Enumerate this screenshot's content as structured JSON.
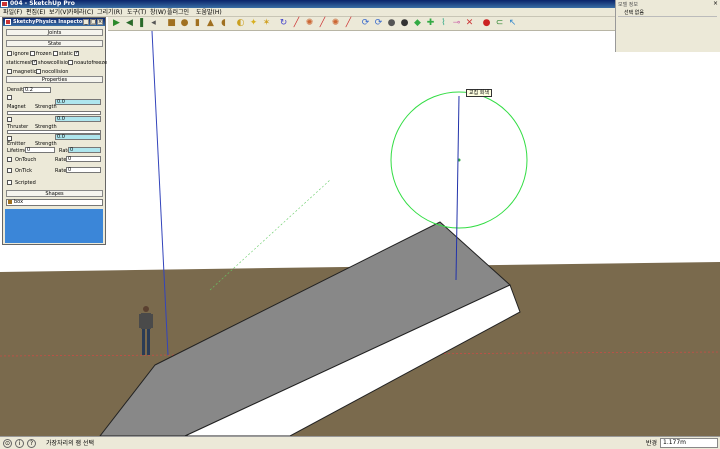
{
  "window": {
    "title": "004 - SketchUp Pro"
  },
  "menu": [
    "파일(F)",
    "편집(E)",
    "보기(V)",
    "카메라(C)",
    "그리기(R)",
    "도구(T)",
    "창(W)",
    "플러그인",
    "도움말(H)"
  ],
  "toolbar": {
    "icons": [
      "play-icon",
      "rewind-icon",
      "pause-icon",
      "undo-icon",
      "box-icon",
      "sphere-icon",
      "cylinder-icon",
      "cone-icon",
      "torus-icon",
      "magnet-icon",
      "lamp-icon",
      "bolt-icon",
      "rotate-icon",
      "line-icon",
      "gear-icon",
      "pencil-icon",
      "rope-icon",
      "hinge-icon",
      "servo-icon",
      "piston-icon",
      "slider-icon",
      "ball-icon",
      "cube-green-icon",
      "joint-icon",
      "spring-icon",
      "link-icon",
      "delete-icon",
      "record-icon",
      "magnet-red-icon",
      "arrow-icon"
    ]
  },
  "right_panel": {
    "header": "모델 정보",
    "row_label": "선택 없음"
  },
  "physics": {
    "title": "SketchyPhysics Inspector",
    "joints_label": "Joints",
    "state_label": "State",
    "state_options": [
      {
        "label": "ignore",
        "checked": false
      },
      {
        "label": "frozen",
        "checked": false
      },
      {
        "label": "static",
        "checked": true
      },
      {
        "label": "staticmesh",
        "checked": true
      },
      {
        "label": "showcollision",
        "checked": false
      },
      {
        "label": "noautofreeze",
        "checked": false
      },
      {
        "label": "magnetic",
        "checked": false
      },
      {
        "label": "nocollision",
        "checked": false
      }
    ],
    "properties_label": "Properties",
    "density_label": "Density",
    "density_value": "0.2",
    "magnet_label": "Magnet",
    "thruster_label": "Thruster",
    "emitter_label": "Emitter",
    "strength_label": "Strength",
    "strength_value": "0.0",
    "lifetime_label": "Lifetime",
    "lifetime_value": "0",
    "rate_label": "Rate",
    "rate_value": "0",
    "ontouch_label": "OnTouch",
    "ontick_label": "OnTick",
    "scripted_label": "Scripted",
    "shapes_label": "Shapes",
    "shape_value": "box"
  },
  "viewport": {
    "tooltip": "교집 회색",
    "ground_color": "#7a6a4d",
    "slope_color": "#888888",
    "circle_color": "#33dd44"
  },
  "status": {
    "message": "가장자리의 잼 선택",
    "value_label": "반경",
    "value": "1.177m"
  }
}
